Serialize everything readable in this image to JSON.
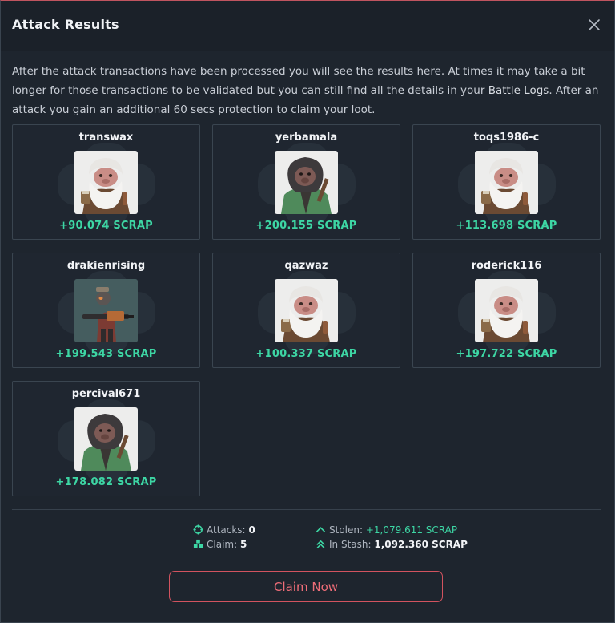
{
  "modal": {
    "title": "Attack Results",
    "intro_before_link": "After the attack transactions have been processed you will see the results here. At times it may take a bit longer for those transactions to be validated but you can still find all the details in your ",
    "intro_link": "Battle Logs",
    "intro_after_link": ". After an attack you gain an additional 60 secs protection to claim your loot."
  },
  "results": [
    {
      "name": "transwax",
      "amount": "+90.074 SCRAP",
      "avatar": "white-monkey-avatar"
    },
    {
      "name": "yerbamala",
      "amount": "+200.155 SCRAP",
      "avatar": "dark-monkey-green-jacket-avatar"
    },
    {
      "name": "toqs1986-c",
      "amount": "+113.698 SCRAP",
      "avatar": "white-monkey-avatar"
    },
    {
      "name": "drakienrising",
      "amount": "+199.543 SCRAP",
      "avatar": "gunner-robot-avatar"
    },
    {
      "name": "qazwaz",
      "amount": "+100.337 SCRAP",
      "avatar": "white-monkey-avatar"
    },
    {
      "name": "roderick116",
      "amount": "+197.722 SCRAP",
      "avatar": "white-monkey-avatar"
    },
    {
      "name": "percival671",
      "amount": "+178.082 SCRAP",
      "avatar": "dark-monkey-green-jacket-avatar"
    }
  ],
  "summary": {
    "attacks_label": "Attacks:",
    "attacks_value": "0",
    "claim_label": "Claim:",
    "claim_value": "5",
    "stolen_label": "Stolen:",
    "stolen_value": "+1,079.611 SCRAP",
    "stash_label": "In Stash:",
    "stash_value": "1,092.360 SCRAP"
  },
  "claim_button": "Claim Now",
  "colors": {
    "accent_green": "#3dd6a4",
    "accent_red": "#d2535f",
    "background": "#1e252e"
  }
}
